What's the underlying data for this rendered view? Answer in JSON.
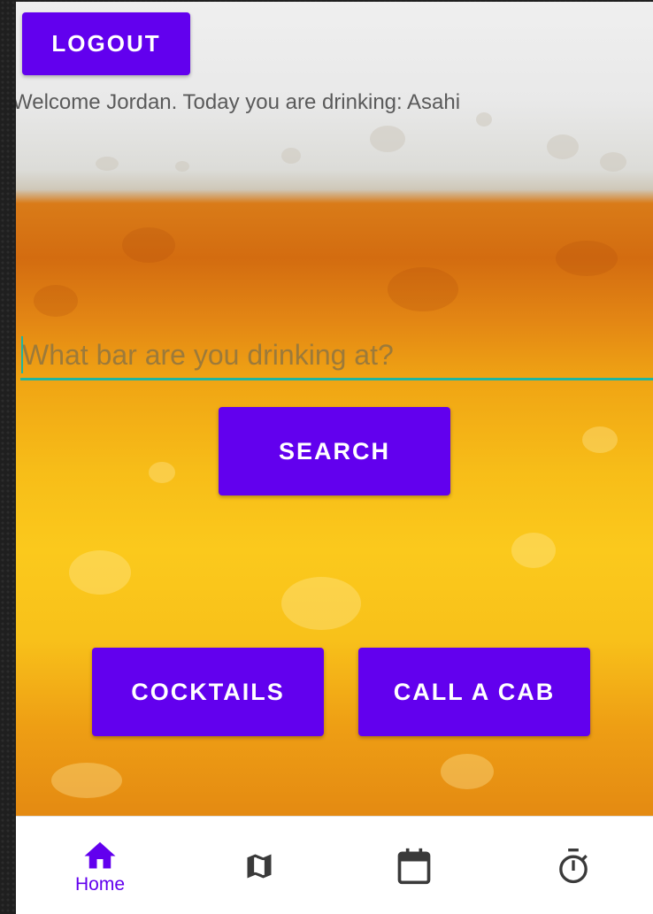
{
  "header": {
    "logout_label": "LOGOUT",
    "welcome_text": "Welcome Jordan. Today you are drinking: Asahi"
  },
  "search": {
    "placeholder": "What bar are you drinking at?",
    "value": "",
    "button_label": "SEARCH"
  },
  "actions": {
    "cocktails_label": "COCKTAILS",
    "cab_label": "CALL A CAB"
  },
  "bottom_nav": {
    "items": [
      {
        "label": "Home",
        "icon": "home-icon",
        "active": true
      },
      {
        "label": "",
        "icon": "map-icon",
        "active": false
      },
      {
        "label": "",
        "icon": "calendar-icon",
        "active": false
      },
      {
        "label": "",
        "icon": "timer-icon",
        "active": false
      }
    ]
  },
  "colors": {
    "primary": "#6200ee",
    "input_underline": "#1fb5a0",
    "nav_inactive": "#3a3a3a"
  }
}
